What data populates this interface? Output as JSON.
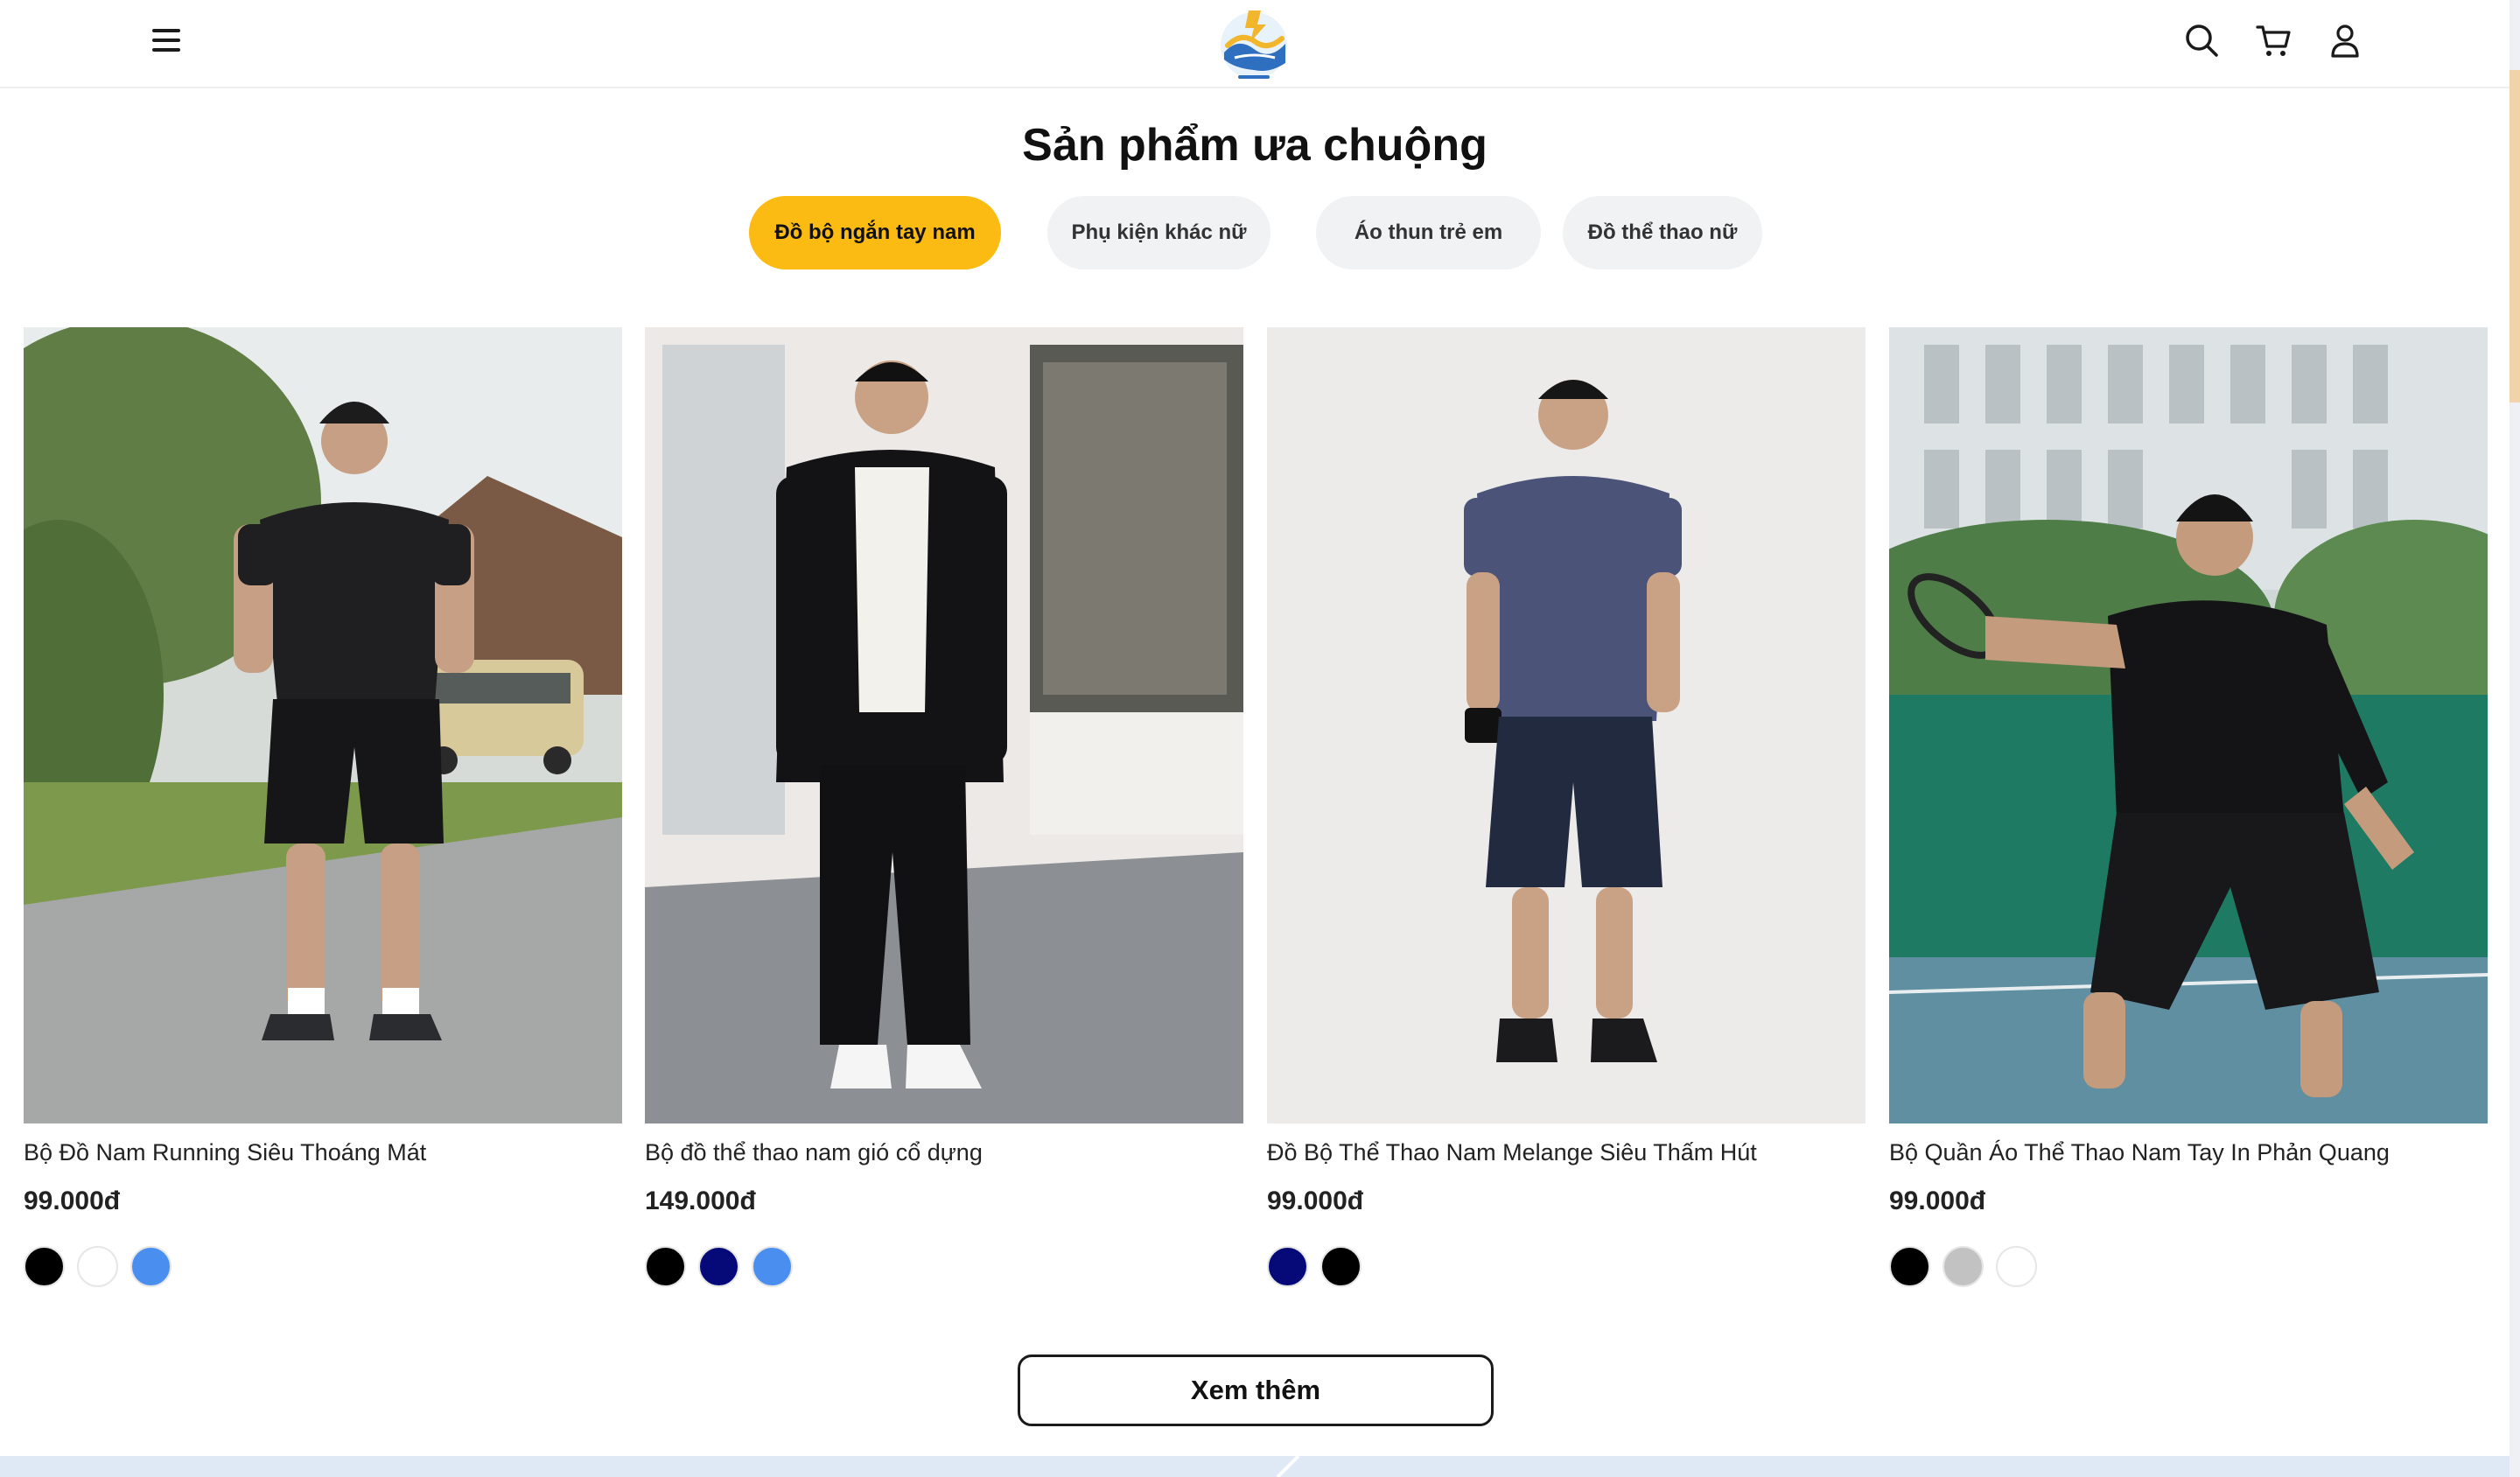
{
  "section": {
    "title": "Sản phẩm ưa chuộng"
  },
  "tabs": [
    {
      "label": "Đồ bộ ngắn tay nam",
      "active": true
    },
    {
      "label": "Phụ kiện khác nữ",
      "active": false
    },
    {
      "label": "Áo thun trẻ em",
      "active": false
    },
    {
      "label": "Đồ thể thao nữ",
      "active": false
    }
  ],
  "products": [
    {
      "name": "Bộ Đồ Nam Running Siêu Thoáng Mát",
      "price": "99.000đ",
      "swatches": [
        "#000000",
        "#ffffff",
        "#4a8ff0"
      ]
    },
    {
      "name": "Bộ đồ thể thao nam gió cổ dựng",
      "price": "149.000đ",
      "swatches": [
        "#000000",
        "#050a78",
        "#4a8ff0"
      ]
    },
    {
      "name": "Đồ Bộ Thể Thao Nam Melange Siêu Thấm Hút",
      "price": "99.000đ",
      "swatches": [
        "#050a78",
        "#000000"
      ]
    },
    {
      "name": "Bộ Quần Áo Thể Thao Nam Tay In Phản Quang",
      "price": "99.000đ",
      "swatches": [
        "#000000",
        "#c2c2c2",
        "#ffffff"
      ]
    }
  ],
  "more_button": {
    "label": "Xem thêm"
  },
  "colors": {
    "accent": "#fbbb13",
    "tab_bg": "#f1f2f4"
  },
  "icons": {
    "menu": "hamburger-icon",
    "search": "search-icon",
    "cart": "cart-icon",
    "account": "user-icon"
  }
}
